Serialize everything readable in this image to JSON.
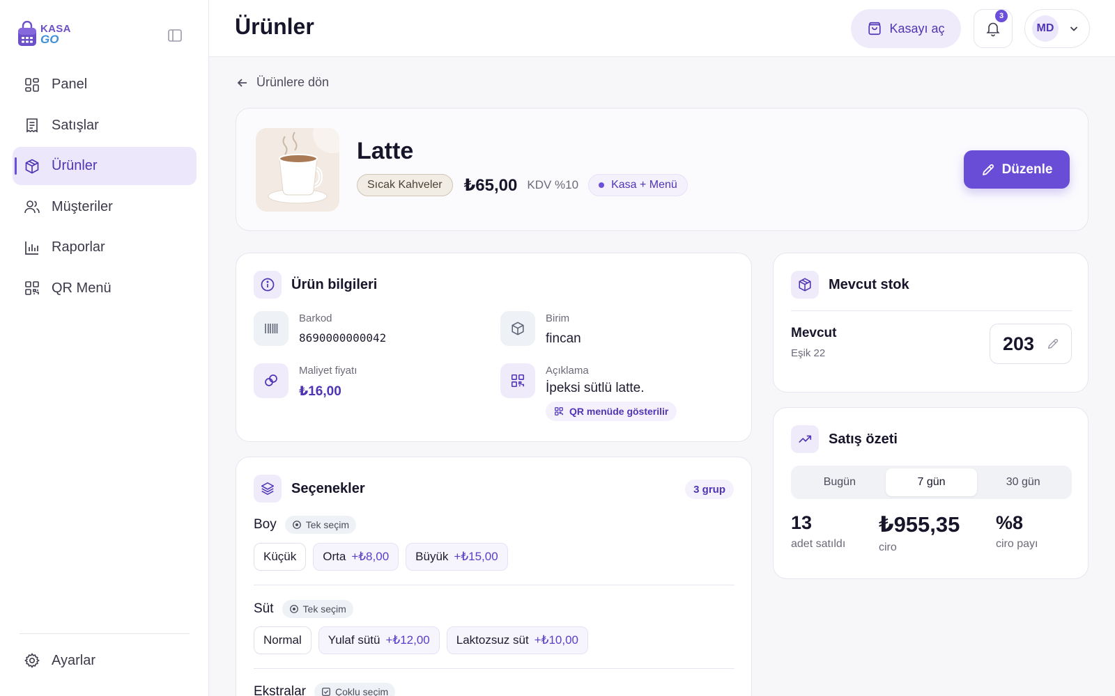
{
  "brand": {
    "line1": "KASA",
    "line2": "GO"
  },
  "sidebar": {
    "items": [
      {
        "label": "Panel",
        "icon": "dashboard-icon",
        "active": false
      },
      {
        "label": "Satışlar",
        "icon": "receipt-icon",
        "active": false
      },
      {
        "label": "Ürünler",
        "icon": "box-icon",
        "active": true
      },
      {
        "label": "Müşteriler",
        "icon": "users-icon",
        "active": false
      },
      {
        "label": "Raporlar",
        "icon": "bar-chart-icon",
        "active": false
      },
      {
        "label": "QR Menü",
        "icon": "qr-code-icon",
        "active": false
      }
    ],
    "settings_label": "Ayarlar"
  },
  "header": {
    "title": "Ürünler",
    "open_register_label": "Kasayı aç",
    "notification_count": "3",
    "user_initials": "MD"
  },
  "back_label": "Ürünlere dön",
  "product": {
    "name": "Latte",
    "category": "Sıcak Kahveler",
    "price": "₺65,00",
    "vat": "KDV %10",
    "channel": "Kasa + Menü",
    "edit_label": "Düzenle"
  },
  "info": {
    "title": "Ürün bilgileri",
    "barcode_label": "Barkod",
    "barcode_value": "8690000000042",
    "unit_label": "Birim",
    "unit_value": "fincan",
    "cost_label": "Maliyet fiyatı",
    "cost_value": "₺16,00",
    "description_label": "Açıklama",
    "description_value": "İpeksi sütlü latte.",
    "qr_note": "QR menüde gösterilir"
  },
  "stock": {
    "title": "Mevcut stok",
    "label": "Mevcut",
    "threshold": "Eşik 22",
    "value": "203"
  },
  "sales": {
    "title": "Satış özeti",
    "tabs": [
      "Bugün",
      "7 gün",
      "30 gün"
    ],
    "active_tab": 1,
    "units_value": "13",
    "units_label": "adet satıldı",
    "revenue_value": "₺955,35",
    "revenue_label": "ciro",
    "share_value": "%8",
    "share_label": "ciro payı"
  },
  "options": {
    "title": "Seçenekler",
    "count": "3 grup",
    "groups": [
      {
        "name": "Boy",
        "mode": "Tek seçim",
        "items": [
          {
            "label": "Küçük",
            "delta": ""
          },
          {
            "label": "Orta",
            "delta": "+₺8,00"
          },
          {
            "label": "Büyük",
            "delta": "+₺15,00"
          }
        ]
      },
      {
        "name": "Süt",
        "mode": "Tek seçim",
        "items": [
          {
            "label": "Normal",
            "delta": ""
          },
          {
            "label": "Yulaf sütü",
            "delta": "+₺12,00"
          },
          {
            "label": "Laktozsuz süt",
            "delta": "+₺10,00"
          }
        ]
      },
      {
        "name": "Ekstralar",
        "mode": "Çoklu seçim",
        "items": []
      }
    ]
  },
  "colors": {
    "accent": "#6a4dd6",
    "accent_soft": "#efebfb",
    "text": "#17152a"
  }
}
